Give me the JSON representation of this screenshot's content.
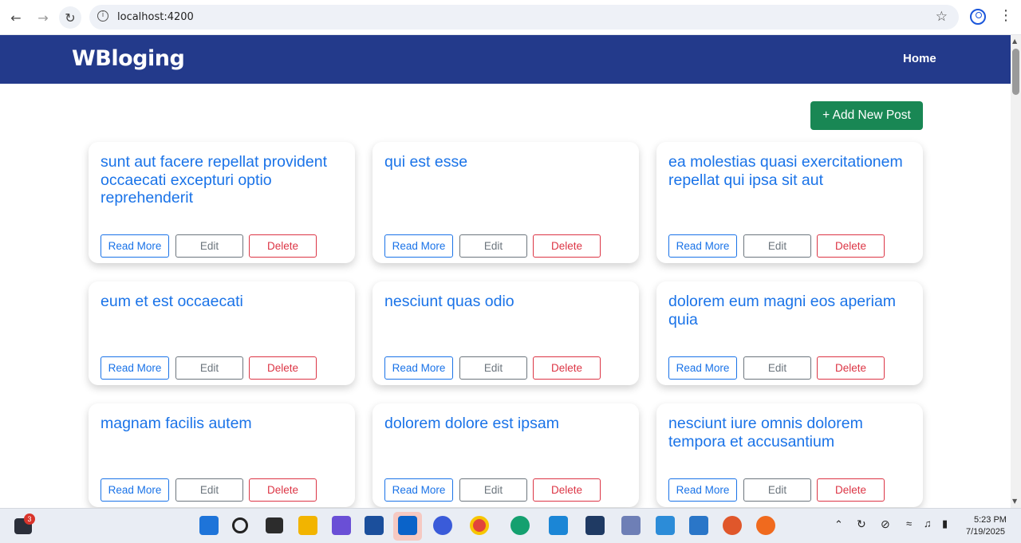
{
  "browser": {
    "url": "localhost:4200"
  },
  "app": {
    "brand": "WBloging",
    "nav_home": "Home",
    "add_post_label": "+ Add New Post"
  },
  "buttons": {
    "read_more": "Read More",
    "edit": "Edit",
    "delete": "Delete"
  },
  "posts": [
    {
      "title": "sunt aut facere repellat provident occaecati excepturi optio reprehenderit"
    },
    {
      "title": "qui est esse"
    },
    {
      "title": "ea molestias quasi exercitationem repellat qui ipsa sit aut"
    },
    {
      "title": "eum et est occaecati"
    },
    {
      "title": "nesciunt quas odio"
    },
    {
      "title": "dolorem eum magni eos aperiam quia"
    },
    {
      "title": "magnam facilis autem"
    },
    {
      "title": "dolorem dolore est ipsam"
    },
    {
      "title": "nesciunt iure omnis dolorem tempora et accusantium"
    }
  ],
  "taskbar": {
    "notification_count": "3",
    "time": "5:23 PM",
    "date": "7/19/2025"
  },
  "colors": {
    "header": "#233a8b",
    "accent": "#1a73e8",
    "success": "#198754",
    "danger": "#dc3545",
    "muted": "#6c757d"
  },
  "icons": [
    "back-arrow-icon",
    "forward-arrow-icon",
    "reload-icon",
    "info-icon",
    "star-icon",
    "profile-icon",
    "menu-icon"
  ]
}
